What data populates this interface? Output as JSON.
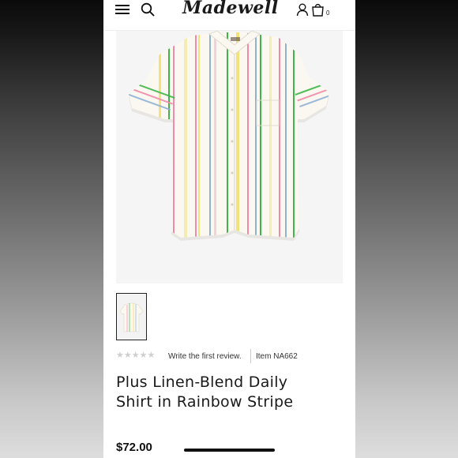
{
  "header": {
    "logo_text": "Madewell",
    "icons": [
      "menu-icon",
      "search-icon",
      "account-icon",
      "bag-icon"
    ],
    "bag_count": "0"
  },
  "product": {
    "image_description_icon": "striped-shirt",
    "review_stars": "★★★★★",
    "write_review": "Write the first review.",
    "item_number": "Item NA662",
    "title_line1": "Plus Linen-Blend Daily",
    "title_line2": "Shirt in Rainbow Stripe",
    "price": "$72.00"
  },
  "colors": {
    "stripe_green": "#3fb54a",
    "stripe_pink": "#f08aa8",
    "stripe_yellow": "#f2e27a",
    "stripe_blue": "#8fb1d6",
    "shirt_base": "#fbf8f1"
  }
}
